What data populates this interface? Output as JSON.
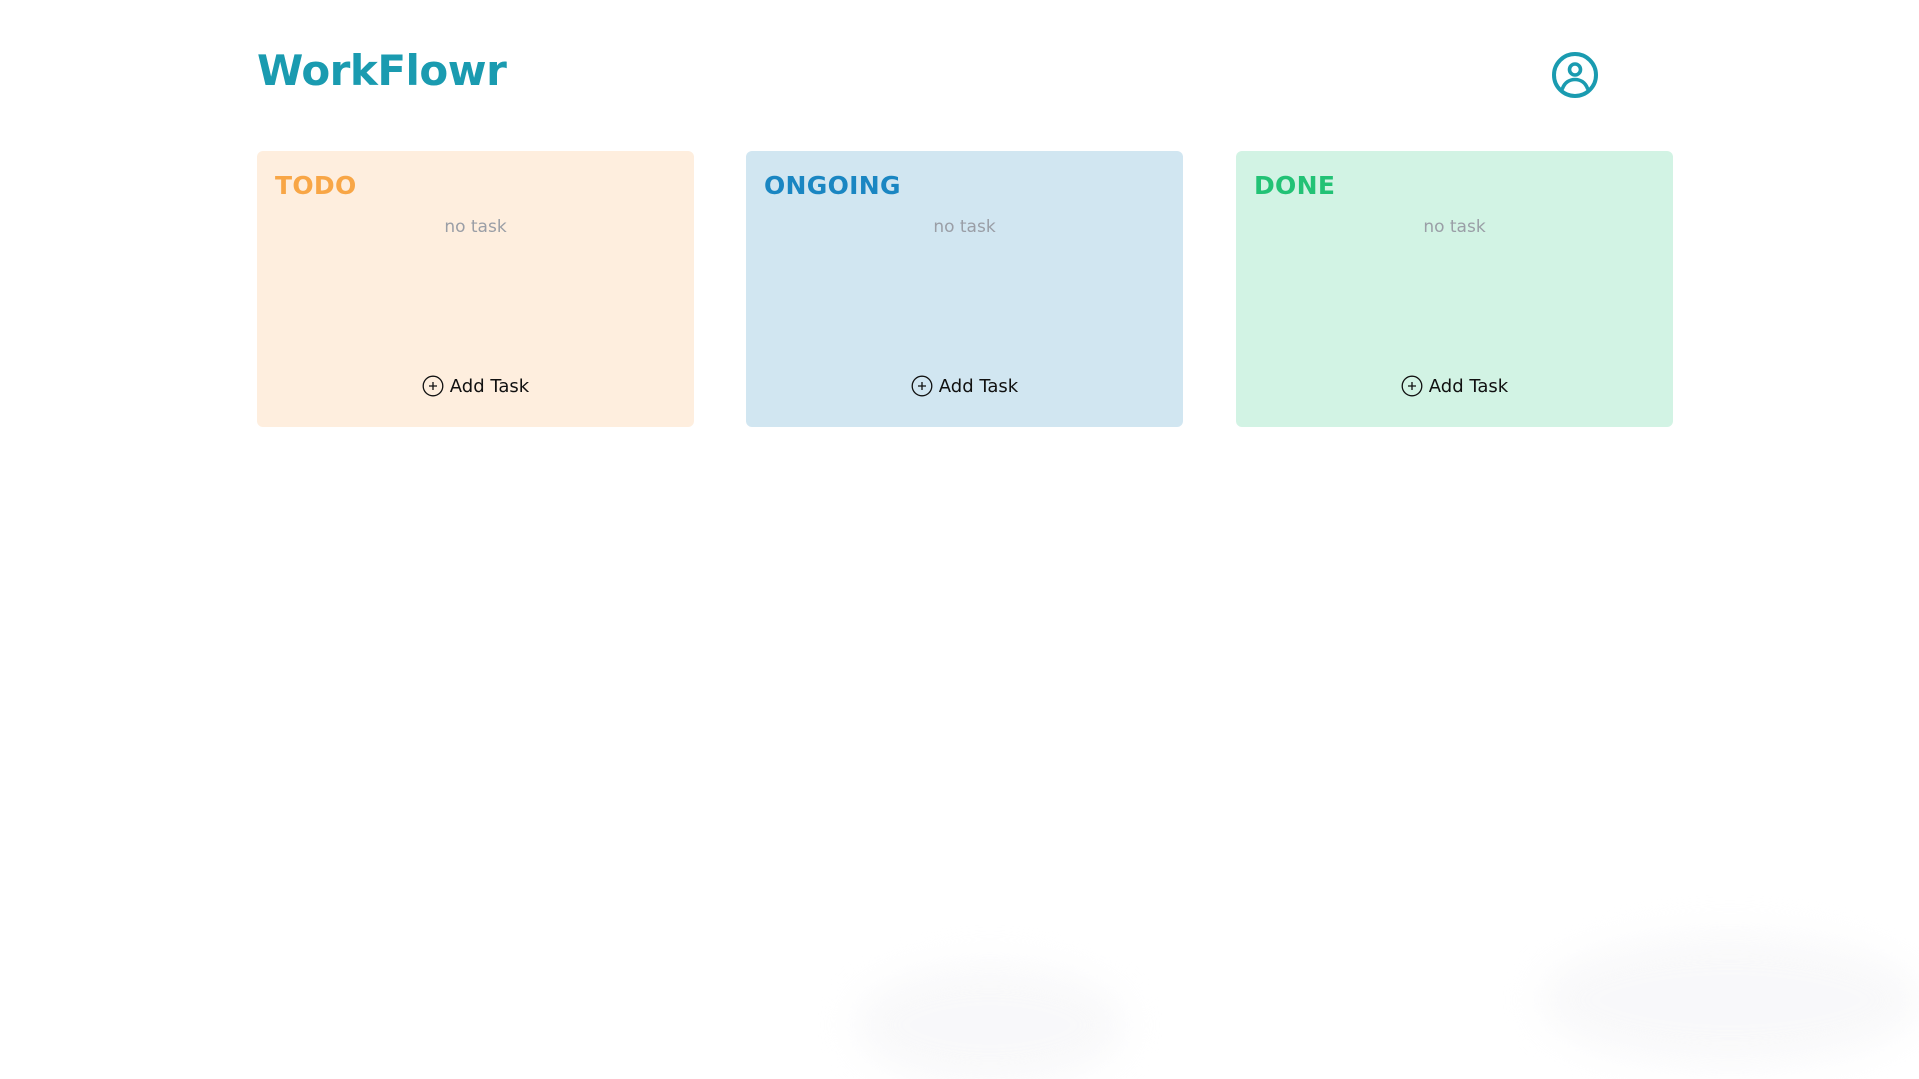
{
  "app": {
    "title": "WorkFlowr",
    "accent_color": "#1a9bb0",
    "user_icon": "user-circle-icon"
  },
  "columns": [
    {
      "id": "todo",
      "title": "TODO",
      "title_color": "#f8a646",
      "background": "#feeede",
      "empty_text": "no task",
      "add_label": "Add Task",
      "add_icon": "plus-circle-icon"
    },
    {
      "id": "ongoing",
      "title": "ONGOING",
      "title_color": "#1a86c2",
      "background": "#d1e6f1",
      "empty_text": "no task",
      "add_label": "Add Task",
      "add_icon": "plus-circle-icon"
    },
    {
      "id": "done",
      "title": "DONE",
      "title_color": "#22c275",
      "background": "#d2f3e4",
      "empty_text": "no task",
      "add_label": "Add Task",
      "add_icon": "plus-circle-icon"
    }
  ]
}
